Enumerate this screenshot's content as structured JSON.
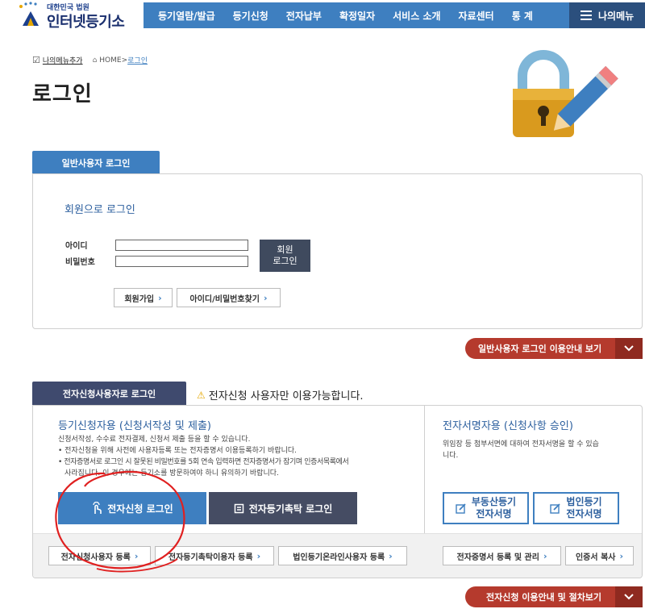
{
  "header": {
    "logo_small": "대한민국 법원",
    "logo_big": "인터넷등기소",
    "nav": [
      "등기열람/발급",
      "등기신청",
      "전자납부",
      "확정일자",
      "서비스 소개",
      "자료센터",
      "통 계"
    ],
    "my_menu": "나의메뉴"
  },
  "breadcrumb": {
    "favorite": "나의메뉴추가",
    "home": "HOME",
    "separator": ">",
    "current": "로그인"
  },
  "page_title": "로그인",
  "general": {
    "tab": "일반사용자 로그인",
    "heading": "회원으로 로그인",
    "id_label": "아이디",
    "pw_label": "비밀번호",
    "id_value": "",
    "pw_value": "",
    "login_line1": "회원",
    "login_line2": "로그인",
    "join": "회원가입",
    "find": "아이디/비밀번호찾기",
    "guide": "일반사용자 로그인 이용안내 보기"
  },
  "electronic": {
    "tab": "전자신청사용자로 로그인",
    "notice": "전자신청 사용자만 이용가능합니다.",
    "left": {
      "title": "등기신청자용 (신청서작성 및 제출)",
      "desc1": "신청서작성, 수수료 전자결제, 신청서 제출 등을 할 수 있습니다.",
      "desc2": "• 전자신청을 위해 사전에 사용자등록 또는 전자증명서 이용등록하기 바랍니다.",
      "desc3": "• 전자증명서로 로그인 시 잘못된 비밀번호를 5회 연속 입력하면 전자증명서가 잠기며 인증서목록에서",
      "desc4": "사라집니다. 이 경우에는 등기소를 방문하여야 하니 유의하기 바랍니다.",
      "btn_login": "전자신청 로그인",
      "btn_trust": "전자등기촉탁 로그인",
      "foot": [
        "전자신청사용자 등록",
        "전자등기촉탁이용자 등록",
        "법인등기온라인사용자 등록"
      ]
    },
    "right": {
      "title": "전자서명자용 (신청사항 승인)",
      "desc1": "위임장 등 첨부서면에 대하여 전자서명을 할 수 있습",
      "desc2": "니다.",
      "btn_re_1": "부동산등기",
      "btn_re_2": "전자서명",
      "btn_corp_1": "법인등기",
      "btn_corp_2": "전자서명",
      "foot": [
        "전자증명서 등록 및 관리",
        "인증서 복사"
      ]
    },
    "guide": "전자신청 이용안내 및 절차보기"
  },
  "colors": {
    "primary": "#3e7fc0",
    "dark_button": "#3f4a5e",
    "guide_red": "#b53a2d",
    "title_blue": "#2c5f9e"
  }
}
